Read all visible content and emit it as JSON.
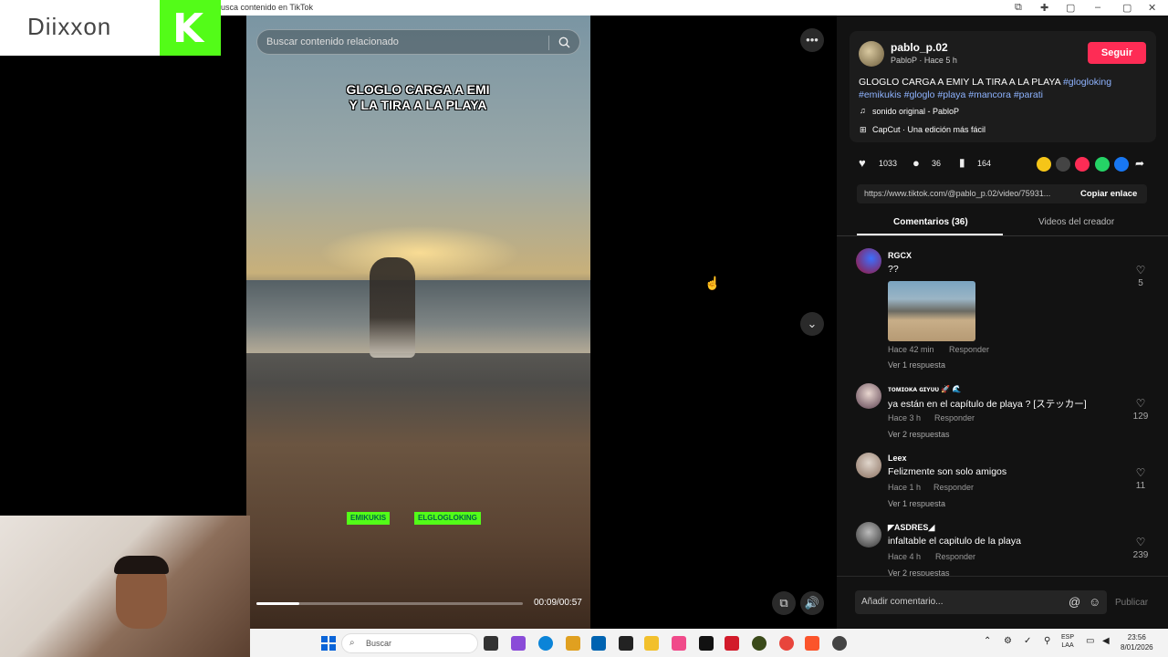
{
  "window": {
    "title": "usca contenido en TikTok"
  },
  "overlay": {
    "brand_name": "Diixxon",
    "kick_letter": "K"
  },
  "video": {
    "search_placeholder": "Buscar contenido relacionado",
    "caption_line1": "GLOGLO CARGA A EMI",
    "caption_line2": "Y LA TIRA A LA PLAYA",
    "tag1": "EMIKUKIS",
    "tag2": "ELGLOGLOKING",
    "time": "00:09/00:57",
    "progress": 0.16
  },
  "panel": {
    "username": "pablo_p.02",
    "subline": "PabloP · Hace 5 h",
    "follow_label": "Seguir",
    "description_text": "GLOGLO CARGA A EMIY LA TIRA A LA PLAYA",
    "hashtags_line1": "#glogloking",
    "hashtags_line2": "#emikukis #gloglo #playa #mancora #parati",
    "sound": "sonido original - PabloP",
    "capcut": "CapCut · Una edición más fácil",
    "likes": "1033",
    "comments_count": "36",
    "saves": "164",
    "url": "https://www.tiktok.com/@pablo_p.02/video/75931...",
    "copy_label": "Copiar enlace",
    "tab_comments": "Comentarios (36)",
    "tab_creator": "Videos del creador"
  },
  "comments": [
    {
      "name": "RGCX",
      "text": "??",
      "time": "Hace 42 min",
      "reply": "Responder",
      "more": "Ver 1 respuesta",
      "likes": "5"
    },
    {
      "name": "ᴛᴏᴍɪᴏᴋᴀ ɢɪʏᴜᴜ 🚀 🌊",
      "text": "ya están en el capítulo de playa ? [ステッカー]",
      "time": "Hace 3 h",
      "reply": "Responder",
      "more": "Ver 2 respuestas",
      "likes": "129"
    },
    {
      "name": "Leex",
      "text": "Felizmente son solo amigos",
      "time": "Hace 1 h",
      "reply": "Responder",
      "more": "Ver 1 respuesta",
      "likes": "11"
    },
    {
      "name": "◤ASDRES◢",
      "text": "infaltable el capitulo de la playa",
      "time": "Hace 4 h",
      "reply": "Responder",
      "more": "Ver 2 respuestas",
      "likes": "239"
    }
  ],
  "composer": {
    "placeholder": "Añadir comentario...",
    "publish": "Publicar"
  },
  "taskbar": {
    "search": "Buscar",
    "lang1": "ESP",
    "lang2": "LAA",
    "time": "23:56",
    "date": "8/01/2026"
  }
}
